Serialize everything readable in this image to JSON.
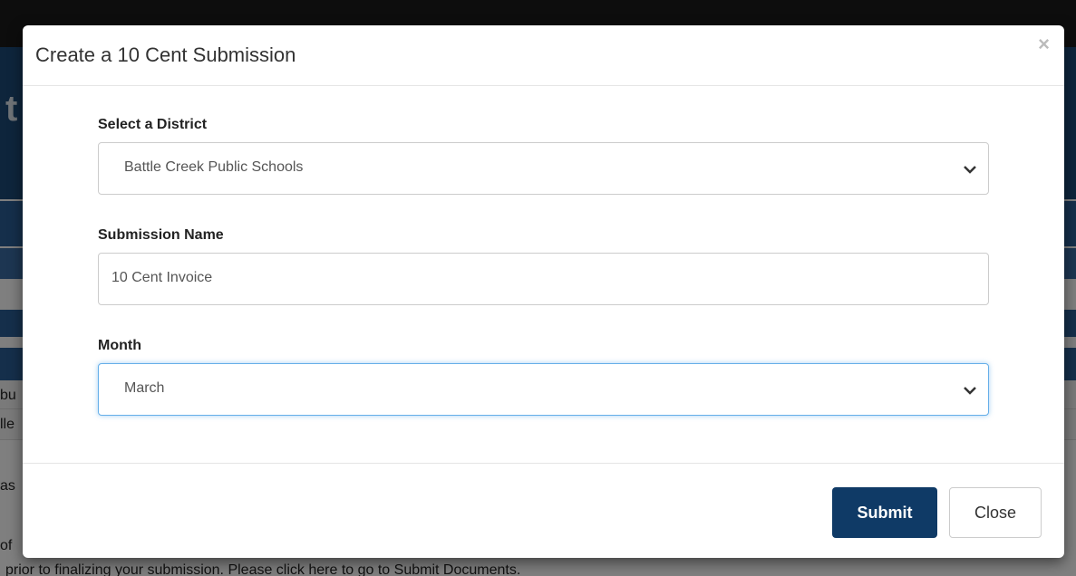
{
  "background": {
    "header_fragment": "t",
    "text_fragments": [
      "bu",
      "lle",
      "as",
      "of"
    ],
    "bottom_text": "prior to finalizing your submission. Please click here to go to Submit Documents."
  },
  "modal": {
    "title": "Create a 10 Cent Submission",
    "close_symbol": "×",
    "district": {
      "label": "Select a District",
      "selected": "Battle Creek Public Schools"
    },
    "submission_name": {
      "label": "Submission Name",
      "value": "10 Cent Invoice"
    },
    "month": {
      "label": "Month",
      "selected": "March"
    },
    "buttons": {
      "submit": "Submit",
      "close": "Close"
    }
  },
  "colors": {
    "primary_button": "#0f3a66",
    "focus_border": "#66afe9",
    "header_blue": "#1d4a78"
  }
}
